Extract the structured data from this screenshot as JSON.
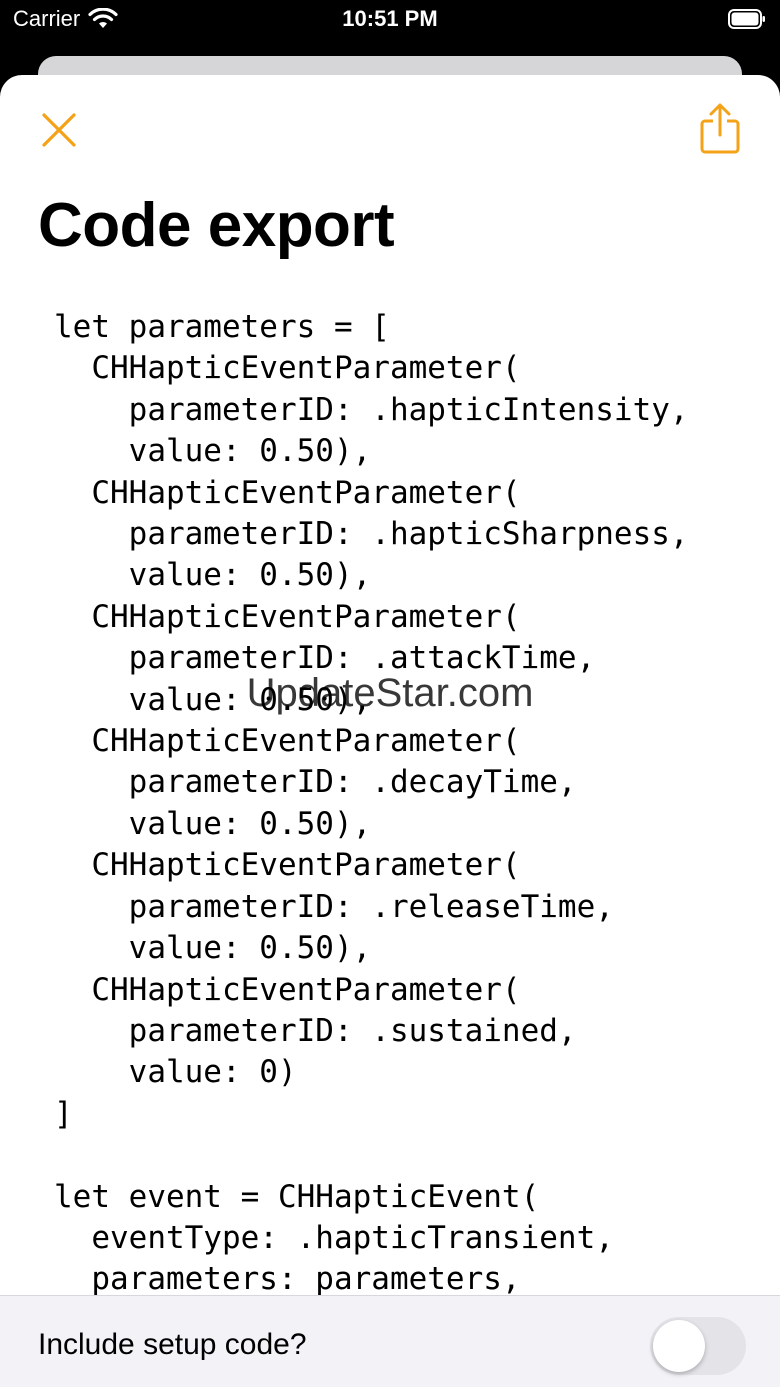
{
  "status_bar": {
    "carrier": "Carrier",
    "time": "10:51 PM"
  },
  "header": {
    "close_icon": "close-x-icon",
    "share_icon": "share-icon",
    "title": "Code export"
  },
  "accent_color": "#F4A217",
  "code": {
    "text": "let parameters = [\n  CHHapticEventParameter(\n    parameterID: .hapticIntensity,\n    value: 0.50),\n  CHHapticEventParameter(\n    parameterID: .hapticSharpness,\n    value: 0.50),\n  CHHapticEventParameter(\n    parameterID: .attackTime,\n    value: 0.50),\n  CHHapticEventParameter(\n    parameterID: .decayTime,\n    value: 0.50),\n  CHHapticEventParameter(\n    parameterID: .releaseTime,\n    value: 0.50),\n  CHHapticEventParameter(\n    parameterID: .sustained,\n    value: 0)\n]\n\nlet event = CHHapticEvent(\n  eventType: .hapticTransient,\n  parameters: parameters,"
  },
  "watermark": "UpdateStar.com",
  "bottom_bar": {
    "setup_label": "Include setup code?",
    "toggle_on": false
  }
}
